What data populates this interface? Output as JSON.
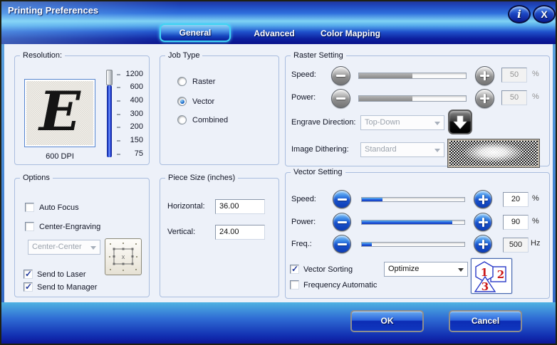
{
  "window": {
    "title": "Printing Preferences"
  },
  "icons": {
    "info": "i",
    "close": "X"
  },
  "tabs": [
    {
      "label": "General",
      "selected": true
    },
    {
      "label": "Advanced",
      "selected": false
    },
    {
      "label": "Color Mapping",
      "selected": false
    }
  ],
  "resolution": {
    "title": "Resolution:",
    "logo_letter": "E",
    "dpi_label": "600 DPI",
    "selected_dpi": "600",
    "ticks": [
      "1200",
      "600",
      "400",
      "300",
      "200",
      "150",
      "75"
    ]
  },
  "job_type": {
    "title": "Job Type",
    "options": [
      {
        "label": "Raster",
        "selected": false
      },
      {
        "label": "Vector",
        "selected": true
      },
      {
        "label": "Combined",
        "selected": false
      }
    ]
  },
  "raster_setting": {
    "title": "Raster Setting",
    "enabled": false,
    "speed_label": "Speed:",
    "speed_value": "50",
    "speed_unit": "%",
    "power_label": "Power:",
    "power_value": "50",
    "power_unit": "%",
    "engrave_direction_label": "Engrave Direction:",
    "engrave_direction_value": "Top-Down",
    "image_dithering_label": "Image Dithering:",
    "image_dithering_value": "Standard"
  },
  "options": {
    "title": "Options",
    "auto_focus_label": "Auto Focus",
    "auto_focus_checked": false,
    "center_engraving_label": "Center-Engraving",
    "center_engraving_checked": false,
    "position_value": "Center-Center",
    "send_to_laser_label": "Send to Laser",
    "send_to_laser_checked": true,
    "send_to_manager_label": "Send to Manager",
    "send_to_manager_checked": true
  },
  "piece_size": {
    "title": "Piece Size (inches)",
    "horizontal_label": "Horizontal:",
    "horizontal_value": "36.00",
    "vertical_label": "Vertical:",
    "vertical_value": "24.00"
  },
  "vector_setting": {
    "title": "Vector Setting",
    "enabled": true,
    "speed_label": "Speed:",
    "speed_value": "20",
    "speed_unit": "%",
    "power_label": "Power:",
    "power_value": "90",
    "power_unit": "%",
    "freq_label": "Freq.:",
    "freq_value": "500",
    "freq_unit": "Hz",
    "vector_sorting_label": "Vector Sorting",
    "vector_sorting_checked": true,
    "sorting_mode_value": "Optimize",
    "frequency_automatic_label": "Frequency Automatic",
    "frequency_automatic_checked": false
  },
  "actions": {
    "ok": "OK",
    "cancel": "Cancel"
  },
  "colors": {
    "accent_cyan": "#3fd2f2",
    "button_blue": "#1a4ecc",
    "fill_blue": "#1f55d4",
    "header_navy": "#0a1690",
    "disabled_gray": "#8a8a8a"
  }
}
